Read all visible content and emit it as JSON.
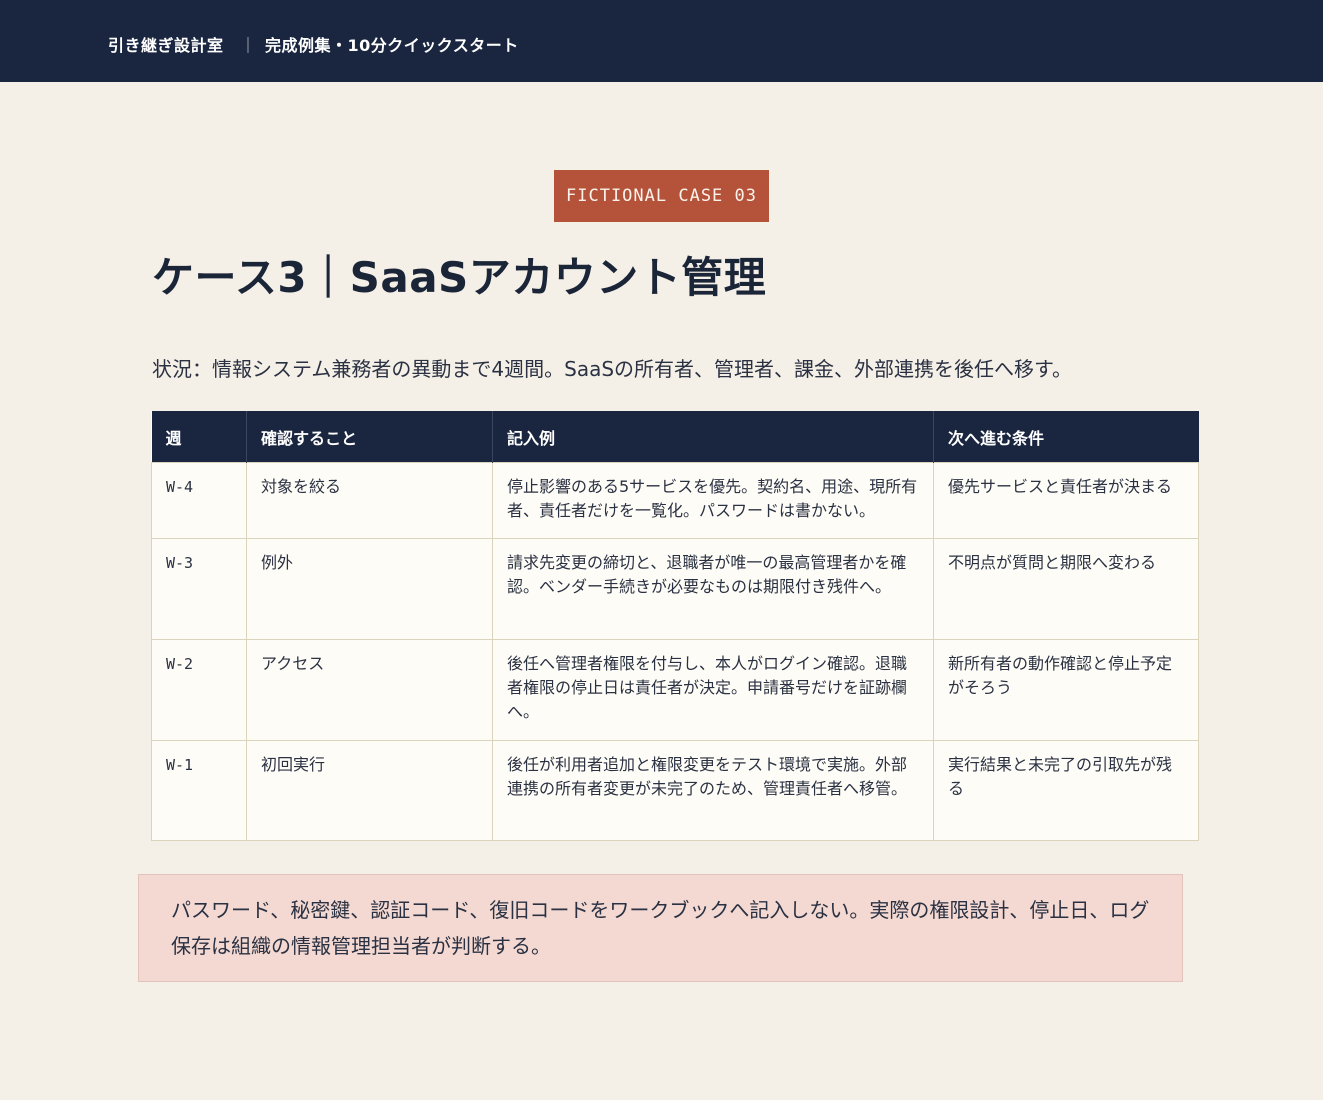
{
  "header": {
    "brand": "引き継ぎ設計室",
    "separator": "｜",
    "subtitle": "完成例集・10分クイックスタート"
  },
  "badge": "FICTIONAL CASE 03",
  "title": "ケース3｜SaaSアカウント管理",
  "situation": "状況：情報システム兼務者の異動まで4週間。SaaSの所有者、管理者、課金、外部連携を後任へ移す。",
  "table": {
    "headers": [
      "週",
      "確認すること",
      "記入例",
      "次へ進む条件"
    ],
    "rows": [
      {
        "week": "W-4",
        "check": "対象を絞る",
        "example": "停止影響のある5サービスを優先。契約名、用途、現所有者、責任者だけを一覧化。パスワードは書かない。",
        "condition": "優先サービスと責任者が決まる"
      },
      {
        "week": "W-3",
        "check": "例外",
        "example": "請求先変更の締切と、退職者が唯一の最高管理者かを確認。ベンダー手続きが必要なものは期限付き残件へ。",
        "condition": "不明点が質問と期限へ変わる"
      },
      {
        "week": "W-2",
        "check": "アクセス",
        "example": "後任へ管理者権限を付与し、本人がログイン確認。退職者権限の停止日は責任者が決定。申請番号だけを証跡欄へ。",
        "condition": "新所有者の動作確認と停止予定がそろう"
      },
      {
        "week": "W-1",
        "check": "初回実行",
        "example": "後任が利用者追加と権限変更をテスト環境で実施。外部連携の所有者変更が未完了のため、管理責任者へ移管。",
        "condition": "実行結果と未完了の引取先が残る"
      }
    ]
  },
  "note": "パスワード、秘密鍵、認証コード、復旧コードをワークブックへ記入しない。実際の権限設計、停止日、ログ保存は組織の情報管理担当者が判断する。",
  "colors": {
    "navy": "#1a2540",
    "accent": "#b5523a",
    "background": "#f5f0e7",
    "note_background": "#f4d9d2"
  }
}
